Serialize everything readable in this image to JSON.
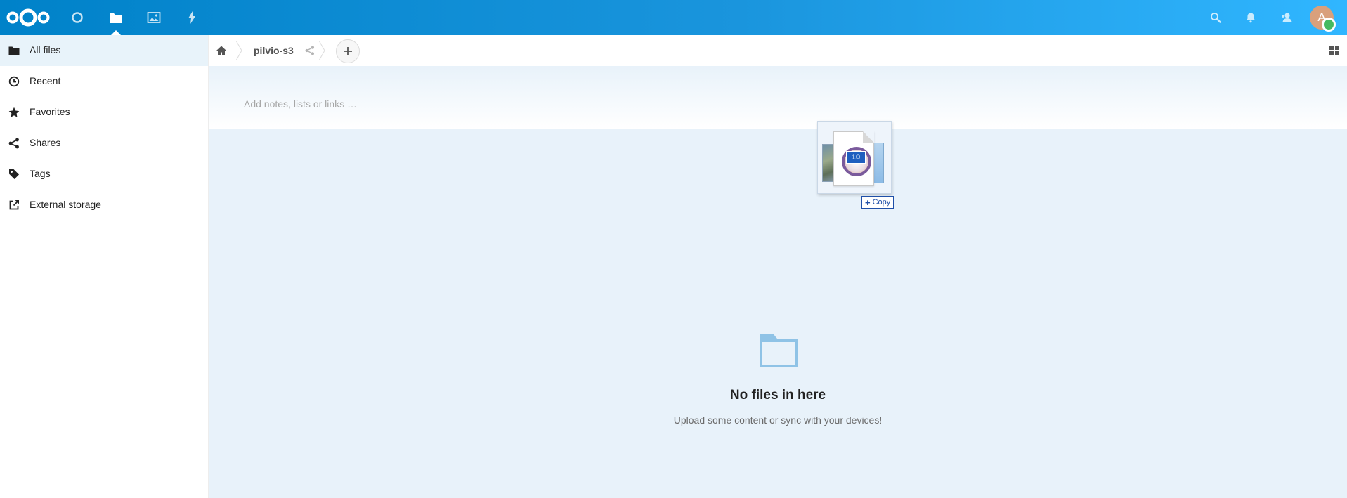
{
  "header": {
    "apps": [
      {
        "name": "dashboard",
        "icon": "dashboard-icon"
      },
      {
        "name": "files",
        "icon": "folder-icon",
        "active": true
      },
      {
        "name": "photos",
        "icon": "image-icon"
      },
      {
        "name": "activity",
        "icon": "lightning-icon"
      }
    ],
    "right_icons": [
      "search-icon",
      "bell-icon",
      "contacts-icon"
    ],
    "avatar_initial": "A"
  },
  "sidebar": {
    "items": [
      {
        "label": "All files",
        "icon": "folder-icon",
        "active": true
      },
      {
        "label": "Recent",
        "icon": "clock-icon"
      },
      {
        "label": "Favorites",
        "icon": "star-icon"
      },
      {
        "label": "Shares",
        "icon": "share-icon"
      },
      {
        "label": "Tags",
        "icon": "tag-icon"
      },
      {
        "label": "External storage",
        "icon": "external-link-icon"
      }
    ]
  },
  "breadcrumb": {
    "folder": "pilvio-s3"
  },
  "notes": {
    "placeholder": "Add notes, lists or links …"
  },
  "empty_state": {
    "title": "No files in here",
    "subtitle": "Upload some content or sync with your devices!"
  },
  "drag": {
    "badge_number": "10",
    "tooltip": "Copy",
    "tooltip_symbol": "+"
  },
  "colors": {
    "header_start": "#0082c9",
    "header_end": "#30b6ff",
    "active_bg": "#e8f3fa",
    "content_bg": "#e8f2fa",
    "folder_empty": "#8fc3e6",
    "status_online": "#46ba61"
  }
}
